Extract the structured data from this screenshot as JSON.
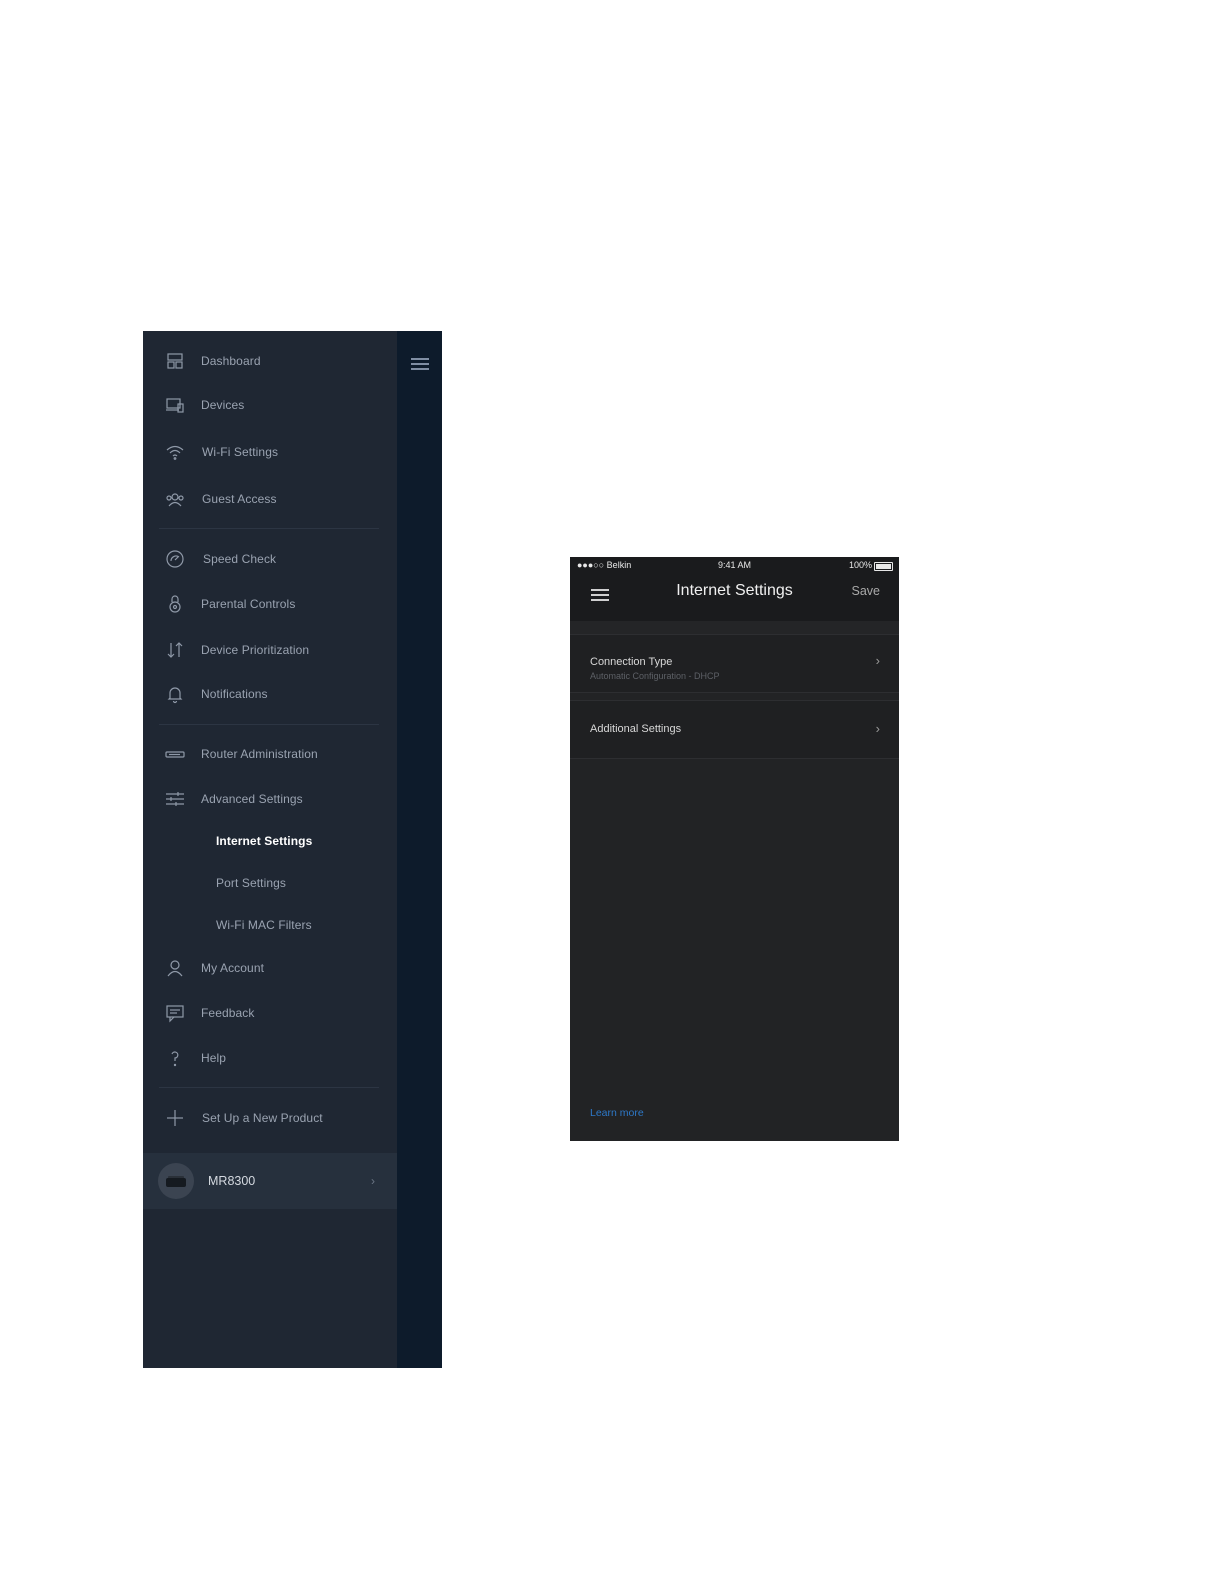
{
  "menu": {
    "items": [
      {
        "label": "Dashboard",
        "icon": "dashboard-icon"
      },
      {
        "label": "Devices",
        "icon": "devices-icon"
      },
      {
        "label": "Wi-Fi Settings",
        "icon": "wifi-icon"
      },
      {
        "label": "Guest Access",
        "icon": "guest-access-icon"
      },
      {
        "label": "Speed Check",
        "icon": "speedometer-icon"
      },
      {
        "label": "Parental Controls",
        "icon": "padlock-icon"
      },
      {
        "label": "Device Prioritization",
        "icon": "up-down-arrows-icon"
      },
      {
        "label": "Notifications",
        "icon": "bell-icon"
      },
      {
        "label": "Router Administration",
        "icon": "router-icon"
      },
      {
        "label": "Advanced Settings",
        "icon": "sliders-icon"
      },
      {
        "label": "Internet Settings",
        "active": true
      },
      {
        "label": "Port Settings"
      },
      {
        "label": "Wi-Fi MAC Filters"
      },
      {
        "label": "My Account",
        "icon": "person-icon"
      },
      {
        "label": "Feedback",
        "icon": "feedback-icon"
      },
      {
        "label": "Help",
        "icon": "question-mark-icon"
      },
      {
        "label": "Set Up a New Product",
        "icon": "plus-icon"
      }
    ],
    "device": {
      "name": "MR8300",
      "chevron": "›"
    }
  },
  "phone": {
    "status": {
      "carrier": "●●●○○ Belkin",
      "time": "9:41 AM",
      "battery": "100%"
    },
    "nav": {
      "title": "Internet Settings",
      "save": "Save"
    },
    "rows": [
      {
        "title": "Connection Type",
        "subtitle": "Automatic Configuration - DHCP",
        "chevron": "›"
      },
      {
        "title": "Additional Settings",
        "chevron": "›"
      }
    ],
    "learn_more": "Learn more"
  },
  "colors": {
    "menu_bg": "#1f2733",
    "menu_strip": "#0d1b2b",
    "phone_bg": "#222325",
    "link": "#2d78c8"
  }
}
